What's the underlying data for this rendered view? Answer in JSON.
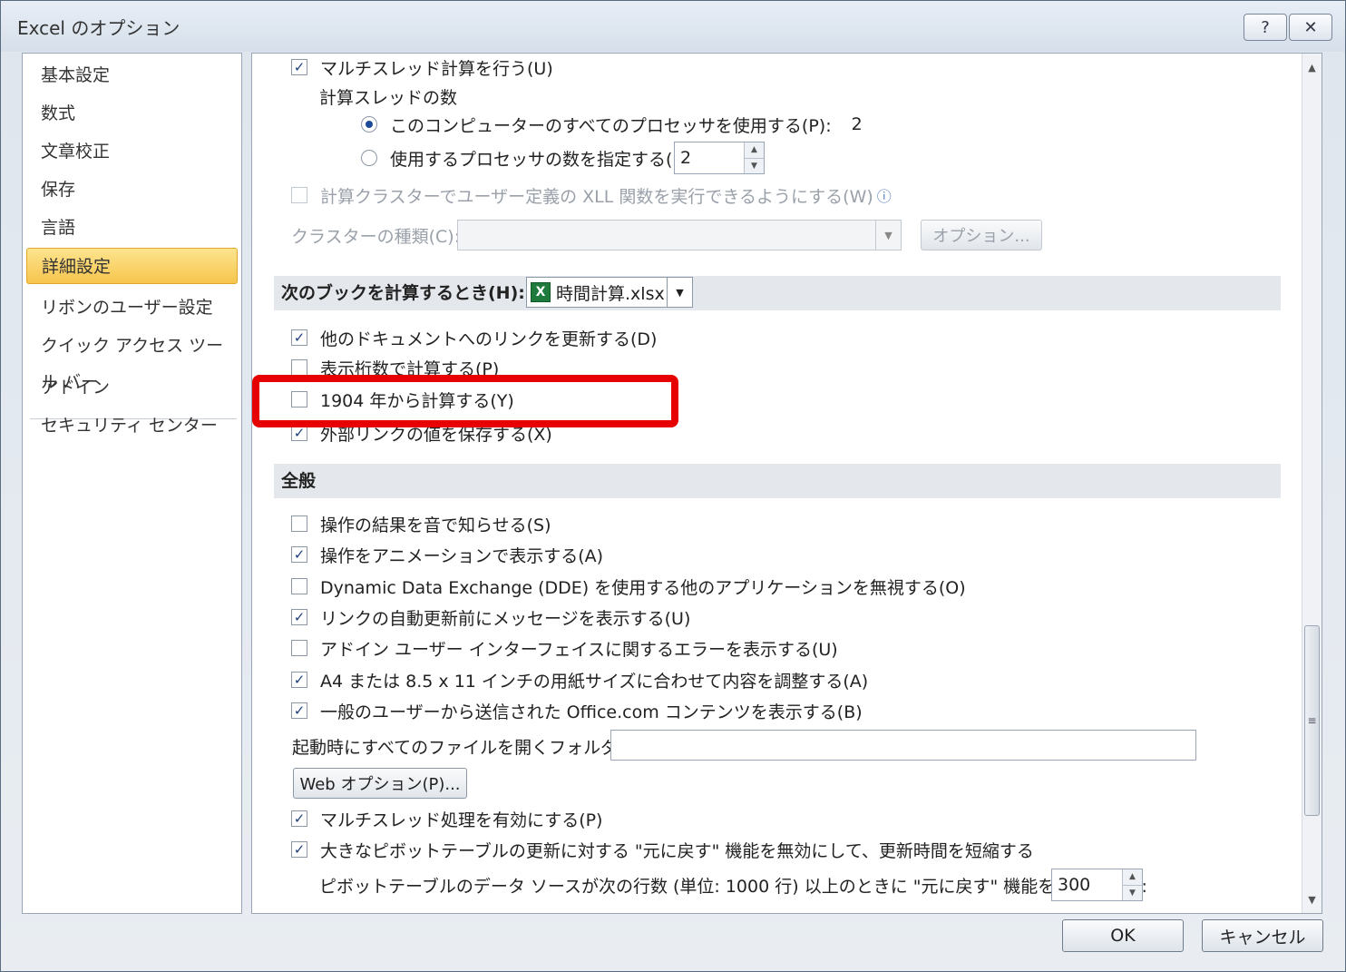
{
  "window": {
    "title": "Excel のオプション",
    "help_glyph": "?",
    "close_glyph": "✕"
  },
  "sidebar": {
    "items": [
      {
        "label": "基本設定"
      },
      {
        "label": "数式"
      },
      {
        "label": "文章校正"
      },
      {
        "label": "保存"
      },
      {
        "label": "言語"
      },
      {
        "label": "詳細設定",
        "selected": true
      },
      {
        "label": "リボンのユーザー設定"
      },
      {
        "label": "クイック アクセス ツール バー"
      },
      {
        "label": "アドイン"
      },
      {
        "label": "セキュリティ センター"
      }
    ]
  },
  "calc": {
    "multithread": {
      "label": "マルチスレッド計算を行う(U)",
      "checked": true
    },
    "thread_count_label": "計算スレッドの数",
    "use_all": {
      "label": "このコンピューターのすべてのプロセッサを使用する(P):",
      "value": "2",
      "selected": true
    },
    "manual": {
      "label": "使用するプロセッサの数を指定する(M):",
      "value": "2",
      "selected": false
    },
    "cluster": {
      "label": "計算クラスターでユーザー定義の XLL 関数を実行できるようにする(W)",
      "checked": false,
      "info_glyph": "ⓘ"
    },
    "cluster_type": {
      "label": "クラスターの種類(C):",
      "value": ""
    },
    "options_button": "オプション..."
  },
  "workbook": {
    "section_label": "次のブックを計算するとき(H):",
    "file": "時間計算.xlsx",
    "file_icon": "X",
    "update_links": {
      "label": "他のドキュメントへのリンクを更新する(D)",
      "checked": true
    },
    "precision": {
      "label": "表示桁数で計算する(P)",
      "checked": false
    },
    "date1904": {
      "label": "1904 年から計算する(Y)",
      "checked": false
    },
    "external": {
      "label": "外部リンクの値を保存する(X)",
      "checked": true
    }
  },
  "general": {
    "section_label": "全般",
    "items": [
      {
        "label": "操作の結果を音で知らせる(S)",
        "checked": false
      },
      {
        "label": "操作をアニメーションで表示する(A)",
        "checked": true
      },
      {
        "label": "Dynamic Data Exchange (DDE) を使用する他のアプリケーションを無視する(O)",
        "checked": false
      },
      {
        "label": "リンクの自動更新前にメッセージを表示する(U)",
        "checked": true
      },
      {
        "label": "アドイン ユーザー インターフェイスに関するエラーを表示する(U)",
        "checked": false
      },
      {
        "label": "A4 または 8.5 x 11 インチの用紙サイズに合わせて内容を調整する(A)",
        "checked": true
      },
      {
        "label": "一般のユーザーから送信された Office.com コンテンツを表示する(B)",
        "checked": true
      }
    ],
    "startup_folder_label": "起動時にすべてのファイルを開くフォルダー(L):",
    "startup_folder_value": "",
    "web_options_button": "Web オプション(P)...",
    "multithread_proc": {
      "label": "マルチスレッド処理を有効にする(P)",
      "checked": true
    },
    "pivot_undo": {
      "label": "大きなピボットテーブルの更新に対する \"元に戻す\" 機能を無効にして、更新時間を短縮する",
      "checked": true
    },
    "pivot_rows_label": "ピボットテーブルのデータ ソースが次の行数 (単位: 1000 行) 以上のときに \"元に戻す\" 機能を無効にする:",
    "pivot_rows_value": "300"
  },
  "footer": {
    "ok": "OK",
    "cancel": "キャンセル"
  },
  "colors": {
    "highlight": "#e60000",
    "selected_nav": "#f6c54c"
  }
}
